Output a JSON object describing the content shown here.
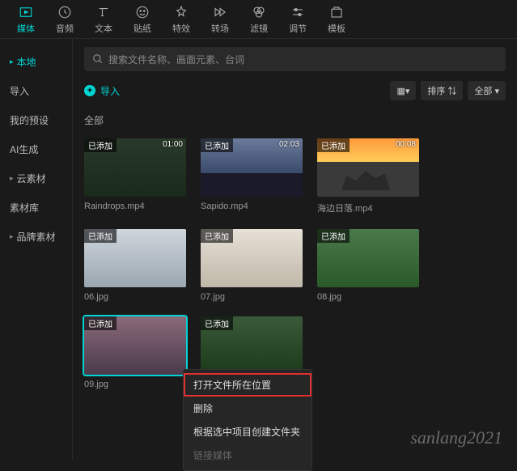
{
  "topTabs": [
    {
      "label": "媒体",
      "active": true
    },
    {
      "label": "音频"
    },
    {
      "label": "文本"
    },
    {
      "label": "贴纸"
    },
    {
      "label": "特效"
    },
    {
      "label": "转场"
    },
    {
      "label": "滤镜"
    },
    {
      "label": "调节"
    },
    {
      "label": "模板"
    }
  ],
  "sidebar": [
    {
      "label": "本地",
      "chev": "▸",
      "active": true
    },
    {
      "label": "导入"
    },
    {
      "label": "我的预设"
    },
    {
      "label": "AI生成"
    },
    {
      "label": "云素材",
      "chev": "▸"
    },
    {
      "label": "素材库"
    },
    {
      "label": "品牌素材",
      "chev": "▸"
    }
  ],
  "search": {
    "placeholder": "搜索文件名称、画面元素、台词"
  },
  "importBtn": "导入",
  "toolbarRight": {
    "view": "▦▾",
    "sort": "排序 ⇅",
    "filter": "全部 ▾"
  },
  "sectionLabel": "全部",
  "addedBadge": "已添加",
  "items": [
    {
      "name": "Raindrops.mp4",
      "duration": "01:00",
      "cls": "t-rain"
    },
    {
      "name": "Sapido.mp4",
      "duration": "02:03",
      "cls": "t-city"
    },
    {
      "name": "海边日落.mp4",
      "duration": "00:08",
      "cls": "t-sunset"
    },
    {
      "name": "06.jpg",
      "cls": "t-p1"
    },
    {
      "name": "07.jpg",
      "cls": "t-p2"
    },
    {
      "name": "08.jpg",
      "cls": "t-p3"
    },
    {
      "name": "09.jpg",
      "cls": "t-p4",
      "selected": true
    },
    {
      "name": "",
      "cls": "t-p5"
    }
  ],
  "contextMenu": [
    {
      "label": "打开文件所在位置",
      "highlighted": true
    },
    {
      "label": "删除"
    },
    {
      "label": "根据选中项目创建文件夹"
    },
    {
      "label": "链接媒体",
      "disabled": true
    }
  ],
  "watermark": "sanlang2021"
}
